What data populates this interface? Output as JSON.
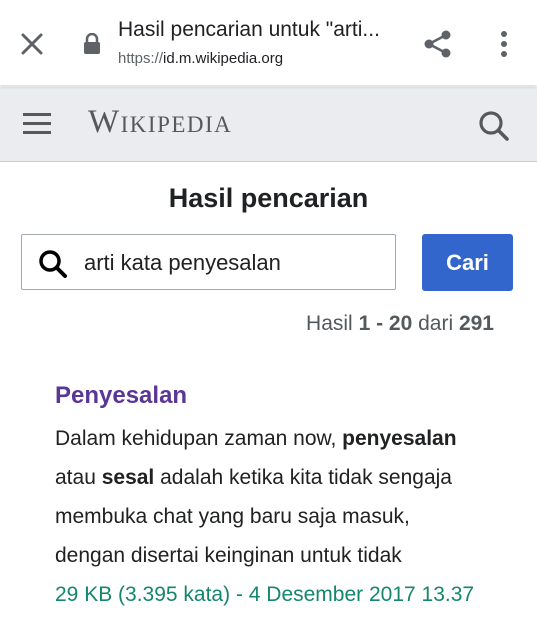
{
  "browser": {
    "title": "Hasil pencarian untuk \"arti...",
    "url_scheme": "https://",
    "url_host": "id.m.wikipedia.org",
    "icons": [
      "close-icon",
      "lock-icon",
      "share-icon",
      "more-vert-icon"
    ]
  },
  "header": {
    "logo": "Wikipedia",
    "icons": [
      "hamburger-icon",
      "search-icon"
    ]
  },
  "main": {
    "heading": "Hasil pencarian",
    "search_query": "arti kata penyesalan",
    "search_button": "Cari",
    "count": {
      "prefix": "Hasil ",
      "range": "1 - 20",
      "middle": " dari ",
      "total": "291"
    }
  },
  "results": [
    {
      "title": "Penyesalan",
      "snippet": {
        "l1_a": "Dalam kehidupan zaman now, ",
        "l1_b": "penyesalan",
        "l2_a": "atau ",
        "l2_b": "sesal",
        "l2_c": " adalah ketika kita tidak sengaja",
        "l3": "membuka chat yang baru saja masuk,",
        "l4": "dengan disertai keinginan untuk tidak"
      },
      "meta": "29 KB (3.395 kata) - 4 Desember 2017 13.37"
    }
  ],
  "colors": {
    "link_visited": "#5a3696",
    "button_primary": "#3366cc",
    "meta_green": "#14866d",
    "header_bg": "#eaecf0"
  }
}
